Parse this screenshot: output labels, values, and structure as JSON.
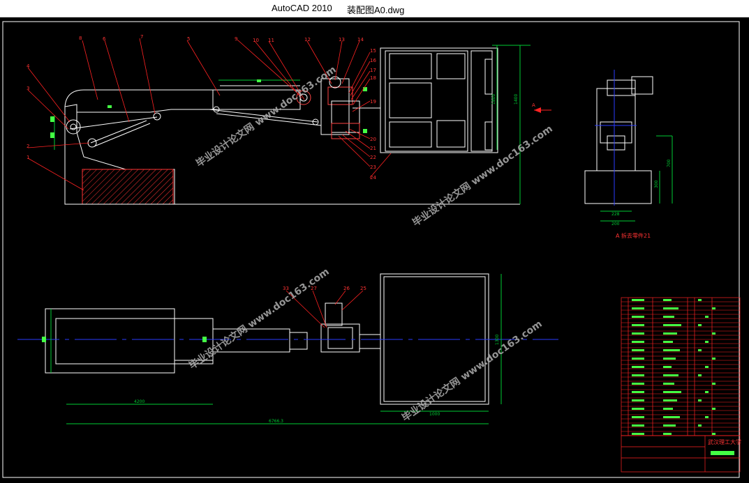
{
  "window": {
    "app_title": "AutoCAD 2010",
    "file_title": "装配图A0.dwg"
  },
  "colors": {
    "background": "#000000",
    "outline": "#ffffff",
    "dimension": "#00cc33",
    "leader": "#ff2222",
    "centerline": "#2a3cff",
    "hatch": "#ff3333",
    "highlight": "#44ff44"
  },
  "drawing": {
    "part_numbers_top": [
      "8",
      "6",
      "7",
      "4",
      "3",
      "2",
      "1",
      "5",
      "9",
      "10",
      "11",
      "12",
      "13",
      "14",
      "15",
      "16",
      "17",
      "18",
      "19",
      "20",
      "21",
      "22",
      "23",
      "24"
    ],
    "part_numbers_bottom": [
      "33",
      "27",
      "26",
      "25"
    ],
    "dims_top": [
      "1400",
      "1800",
      "700",
      "300",
      "228",
      "200"
    ],
    "dims_bottom": [
      "4200",
      "6766.3",
      "1000",
      "1300"
    ],
    "view_label": "A",
    "view_caption": "A 拆去零件21",
    "watermark": "毕业设计论文网 www.doc163.com",
    "university": "武汉理工大学"
  }
}
